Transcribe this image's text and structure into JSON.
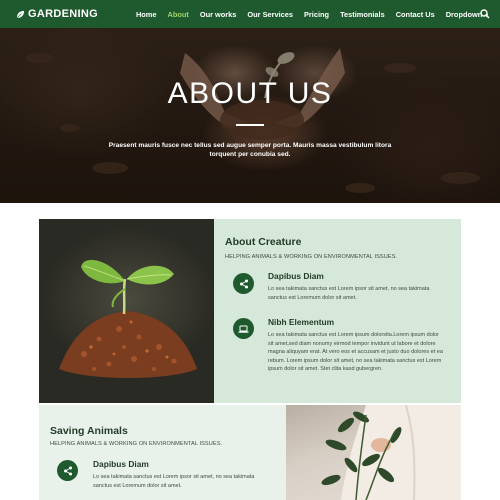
{
  "navbar": {
    "brand": "GARDENING",
    "items": [
      {
        "label": "Home",
        "active": false
      },
      {
        "label": "About",
        "active": true
      },
      {
        "label": "Our works",
        "active": false
      },
      {
        "label": "Our Services",
        "active": false
      },
      {
        "label": "Pricing",
        "active": false
      },
      {
        "label": "Testimonials",
        "active": false
      },
      {
        "label": "Contact Us",
        "active": false
      },
      {
        "label": "Dropdown",
        "active": false
      }
    ],
    "search_icon": "search-icon",
    "colors": {
      "bar": "#1f5a2e",
      "active": "#9ed36a"
    }
  },
  "hero": {
    "title": "ABOUT US",
    "subtitle": "Praesent mauris fusce nec tellus sed augue semper porta. Mauris massa vestibulum litora torquent per conubia sed."
  },
  "about": {
    "title": "About Creature",
    "subtitle": "HELPING ANIMALS & WORKING ON ENVIRONMENTAL ISSUES.",
    "features": [
      {
        "icon": "share-icon",
        "title": "Dapibus Diam",
        "text": "Lo sea takimata sanctus est Lorem ipsor sit amet, no sea takimata sanctus est Loremum dolor sit amet."
      },
      {
        "icon": "laptop-icon",
        "title": "Nibh Elementum",
        "text": "Lo sea takimata sanctus est Lorem ipsum dolorsita.Lorem ipsum dolor sit amet,sed diam nonumy eirmod tempor invidunt ut labore et dolore magna aliquyam erat. At vero eos et accusam et justo duo dolores et ea rebum. Lorem ipsum dolor sit amet, no sea takimata sanctus est Lorem ipsum dolor sit amet. Stet clita kasd gubergren."
      }
    ]
  },
  "saving": {
    "title": "Saving Animals",
    "subtitle": "HELPING ANIMALS & WORKING ON ENVIRONMENTAL ISSUES.",
    "features": [
      {
        "icon": "share-icon",
        "title": "Dapibus Diam",
        "text": "Lo sea takimata sanctus est Lorem ipsor sit amet, no sea takimata sanctus est Loremum dolor sit amet."
      }
    ]
  }
}
